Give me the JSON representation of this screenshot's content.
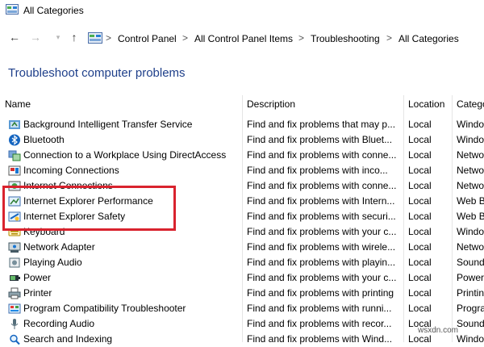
{
  "window": {
    "title": "All Categories"
  },
  "nav": {
    "back_icon": "back-arrow-icon",
    "forward_icon": "forward-arrow-icon",
    "recent_icon": "chevron-down-icon",
    "up_icon": "up-arrow-icon"
  },
  "breadcrumb": {
    "items": [
      "Control Panel",
      "All Control Panel Items",
      "Troubleshooting",
      "All Categories"
    ],
    "separator": ">"
  },
  "page": {
    "heading": "Troubleshoot computer problems"
  },
  "columns": [
    "Name",
    "Description",
    "Location",
    "Catego"
  ],
  "rows": [
    {
      "name": "Background Intelligent Transfer Service",
      "desc": "Find and fix problems that may p...",
      "loc": "Local",
      "cat": "Windo",
      "icon": "bits-icon"
    },
    {
      "name": "Bluetooth",
      "desc": "Find and fix problems with Bluet...",
      "loc": "Local",
      "cat": "Windo",
      "icon": "bluetooth-icon"
    },
    {
      "name": "Connection to a Workplace Using DirectAccess",
      "desc": "Find and fix problems with conne...",
      "loc": "Local",
      "cat": "Netwo",
      "icon": "directaccess-icon"
    },
    {
      "name": "Incoming Connections",
      "desc": "Find and fix problems with inco...",
      "loc": "Local",
      "cat": "Netwo",
      "icon": "incoming-connections-icon"
    },
    {
      "name": "Internet Connections",
      "desc": "Find and fix problems with conne...",
      "loc": "Local",
      "cat": "Netwo",
      "icon": "internet-connections-icon"
    },
    {
      "name": "Internet Explorer Performance",
      "desc": "Find and fix problems with Intern...",
      "loc": "Local",
      "cat": "Web B",
      "icon": "ie-performance-icon"
    },
    {
      "name": "Internet Explorer Safety",
      "desc": "Find and fix problems with securi...",
      "loc": "Local",
      "cat": "Web B",
      "icon": "ie-safety-icon"
    },
    {
      "name": "Keyboard",
      "desc": "Find and fix problems with your c...",
      "loc": "Local",
      "cat": "Windo",
      "icon": "keyboard-icon"
    },
    {
      "name": "Network Adapter",
      "desc": "Find and fix problems with wirele...",
      "loc": "Local",
      "cat": "Netwo",
      "icon": "network-adapter-icon"
    },
    {
      "name": "Playing Audio",
      "desc": "Find and fix problems with playin...",
      "loc": "Local",
      "cat": "Sound",
      "icon": "audio-icon"
    },
    {
      "name": "Power",
      "desc": "Find and fix problems with your c...",
      "loc": "Local",
      "cat": "Power",
      "icon": "power-icon"
    },
    {
      "name": "Printer",
      "desc": "Find and fix problems with printing",
      "loc": "Local",
      "cat": "Printin",
      "icon": "printer-icon"
    },
    {
      "name": "Program Compatibility Troubleshooter",
      "desc": "Find and fix problems with runni...",
      "loc": "Local",
      "cat": "Progra",
      "icon": "program-compat-icon"
    },
    {
      "name": "Recording Audio",
      "desc": "Find and fix problems with recor...",
      "loc": "Local",
      "cat": "Sound",
      "icon": "microphone-icon"
    },
    {
      "name": "Search and Indexing",
      "desc": "Find and fix problems with Wind...",
      "loc": "Local",
      "cat": "Windo",
      "icon": "search-indexing-icon"
    }
  ],
  "watermark": "wsxdn.com"
}
